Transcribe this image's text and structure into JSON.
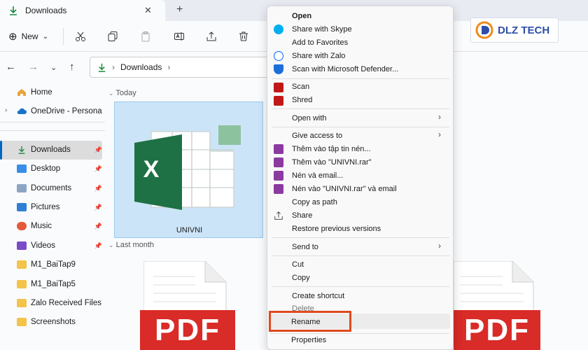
{
  "tab": {
    "title": "Downloads",
    "close": "✕",
    "add": "+"
  },
  "toolbar": {
    "new_label": "New",
    "new_plus": "⊕",
    "new_chev": "⌄"
  },
  "address": {
    "path": "Downloads",
    "sep1": "›",
    "sep2": "›"
  },
  "sidebar": {
    "home": "Home",
    "onedrive": "OneDrive - Persona",
    "downloads": "Downloads",
    "desktop": "Desktop",
    "documents": "Documents",
    "pictures": "Pictures",
    "music": "Music",
    "videos": "Videos",
    "f1": "M1_BaiTap9",
    "f2": "M1_BaiTap5",
    "f3": "Zalo Received Files",
    "f4": "Screenshots"
  },
  "main": {
    "group_today": "Today",
    "group_last_month": "Last month",
    "file_name": "UNIVNI",
    "pdf_label": "PDF"
  },
  "logo": {
    "text": "DLZ TECH"
  },
  "context_menu": {
    "open": "Open",
    "share_skype": "Share with Skype",
    "add_favorites": "Add to Favorites",
    "share_zalo": "Share with Zalo",
    "scan_defender": "Scan with Microsoft Defender...",
    "scan": "Scan",
    "shred": "Shred",
    "open_with": "Open with",
    "give_access": "Give access to",
    "add_archive": "Thêm vào tập tin nén...",
    "add_rar": "Thêm vào \"UNIVNI.rar\"",
    "compress_email": "Nén và email...",
    "compress_rar_email": "Nén vào \"UNIVNI.rar\" và email",
    "copy_path": "Copy as path",
    "share": "Share",
    "restore": "Restore previous versions",
    "send_to": "Send to",
    "cut": "Cut",
    "copy": "Copy",
    "create_shortcut": "Create shortcut",
    "delete": "Delete",
    "rename": "Rename",
    "properties": "Properties",
    "chevron": "›"
  },
  "colors": {
    "accent": "#0067c0",
    "selection": "#cce4f7",
    "highlight_box": "#e04a1f",
    "excel_green": "#1e7145",
    "pdf_red": "#d92b27",
    "mcafee_red": "#c01818",
    "winrar": "#8b3aa0"
  }
}
